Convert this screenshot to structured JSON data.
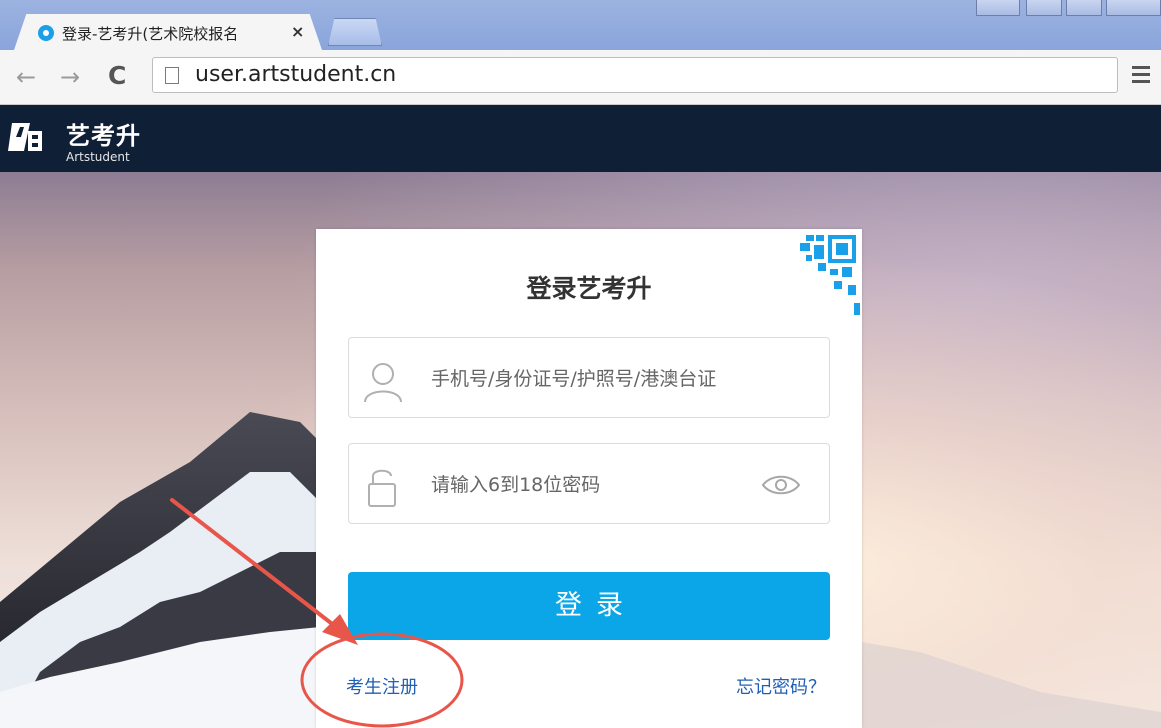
{
  "browser": {
    "tab_title": "登录-艺考升(艺术院校报名",
    "tab_close": "×",
    "url": "user.artstudent.cn",
    "back_glyph": "←",
    "forward_glyph": "→",
    "reload_glyph": "C"
  },
  "site": {
    "brand_name": "艺考升",
    "brand_sub": "Artstudent"
  },
  "login": {
    "title": "登录艺考升",
    "account_placeholder": "手机号/身份证号/护照号/港澳台证",
    "password_placeholder": "请输入6到18位密码",
    "submit_label": "登录",
    "register_link": "考生注册",
    "forgot_link": "忘记密码？"
  },
  "colors": {
    "accent": "#0aa6e8",
    "header_bg": "#0f1f36",
    "link": "#1f5fb5",
    "annotation": "#e8564a"
  },
  "icons": [
    "user-icon",
    "lock-icon",
    "eye-icon",
    "qr-code-icon",
    "page-icon",
    "menu-icon"
  ]
}
